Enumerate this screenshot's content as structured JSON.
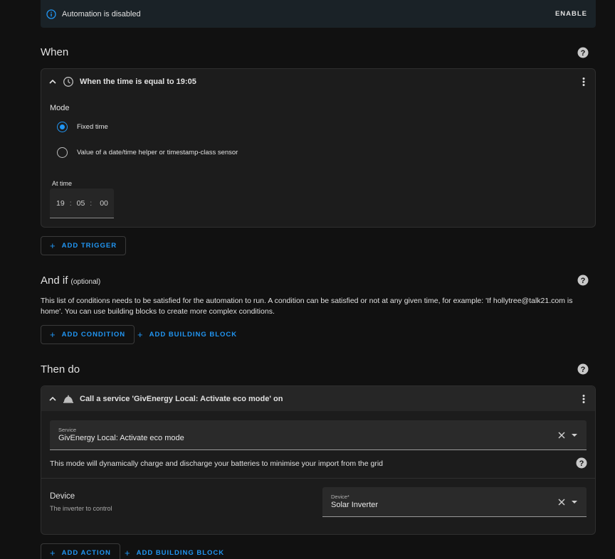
{
  "banner": {
    "text": "Automation is disabled",
    "action": "ENABLE"
  },
  "when": {
    "title": "When",
    "trigger": {
      "title": "When the time is equal to 19:05",
      "mode_label": "Mode",
      "options": [
        "Fixed time",
        "Value of a date/time helper or timestamp-class sensor"
      ],
      "selected": "Fixed time",
      "time_label": "At time",
      "hours": "19",
      "minutes": "05",
      "seconds": "00"
    },
    "add_trigger": "ADD TRIGGER"
  },
  "and_if": {
    "title": "And if",
    "optional": "(optional)",
    "description": "This list of conditions needs to be satisfied for the automation to run. A condition can be satisfied or not at any given time, for example: 'If hollytree@talk21.com is home'. You can use building blocks to create more complex conditions.",
    "add_condition": "ADD CONDITION",
    "add_building_block": "ADD BUILDING BLOCK"
  },
  "then_do": {
    "title": "Then do",
    "action": {
      "title": "Call a service 'GivEnergy Local: Activate eco mode' on",
      "service_label": "Service",
      "service_value": "GivEnergy Local: Activate eco mode",
      "service_description": "This mode will dynamically charge and discharge your batteries to minimise your import from the grid",
      "device_title": "Device",
      "device_subtitle": "The inverter to control",
      "device_label": "Device*",
      "device_value": "Solar Inverter"
    },
    "add_action": "ADD ACTION",
    "add_building_block": "ADD BUILDING BLOCK"
  },
  "colors": {
    "accent": "#2196f3",
    "background": "#111111",
    "card": "#1c1c1c",
    "banner": "#1a2227"
  }
}
